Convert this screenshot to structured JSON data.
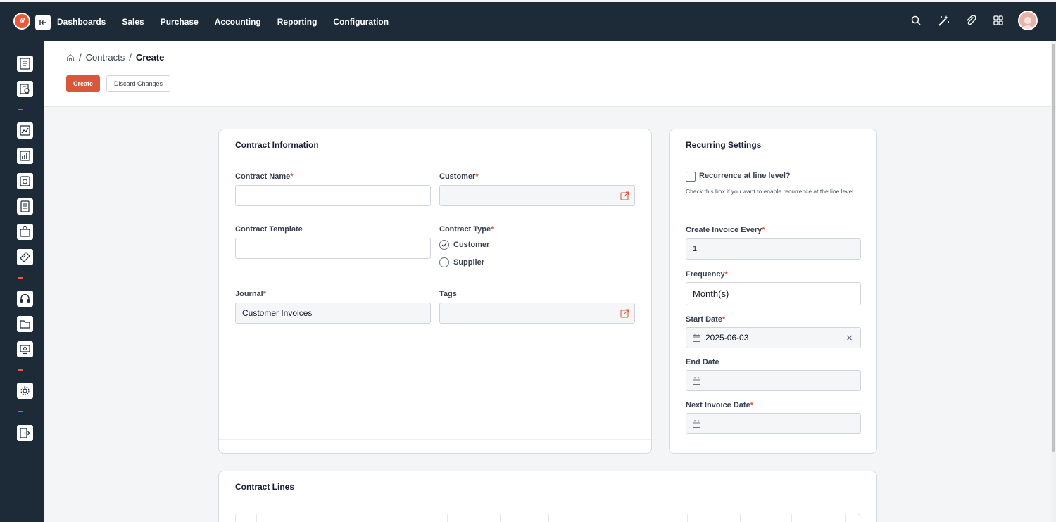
{
  "nav": {
    "items": [
      "Dashboards",
      "Sales",
      "Purchase",
      "Accounting",
      "Reporting",
      "Configuration"
    ]
  },
  "top_icons": [
    "search-icon",
    "magic-wand-icon",
    "paperclip-icon",
    "apps-grid-icon",
    "user-avatar"
  ],
  "sidebar": {
    "items": [
      "dashboard-icon",
      "report-icon",
      "sales-icon",
      "chart-icon",
      "invoice-icon",
      "document-icon",
      "purchase-icon",
      "ticket-icon",
      "support-icon",
      "folder-icon",
      "monitor-icon",
      "settings-icon",
      "logout-icon"
    ]
  },
  "breadcrumb": {
    "parent": "Contracts",
    "current": "Create",
    "separator": "/"
  },
  "toolbar": {
    "create_label": "Create",
    "discard_label": "Discard Changes"
  },
  "contract_info": {
    "title": "Contract Information",
    "contract_name_label": "Contract Name",
    "contract_name_value": "",
    "customer_label": "Customer",
    "customer_value": "",
    "template_label": "Contract Template",
    "template_value": "",
    "type_label": "Contract Type",
    "type_options": [
      "Customer",
      "Supplier"
    ],
    "type_selected": "Customer",
    "journal_label": "Journal",
    "journal_value": "Customer Invoices",
    "tags_label": "Tags",
    "tags_value": ""
  },
  "recurring": {
    "title": "Recurring Settings",
    "line_level_label": "Recurrence at line level?",
    "line_level_help": "Check this box if you want to enable recurrence at the line level.",
    "line_level_checked": false,
    "invoice_every_label": "Create Invoice Every",
    "invoice_every_value": "1",
    "frequency_label": "Frequency",
    "frequency_value": "Month(s)",
    "start_date_label": "Start Date",
    "start_date_value": "2025-06-03",
    "end_date_label": "End Date",
    "end_date_value": "",
    "next_invoice_label": "Next Invoice Date",
    "next_invoice_value": ""
  },
  "contract_lines": {
    "title": "Contract Lines"
  },
  "colors": {
    "topbar": "#1d2b38",
    "accent": "#d9573a",
    "background": "#f4f5f7"
  }
}
